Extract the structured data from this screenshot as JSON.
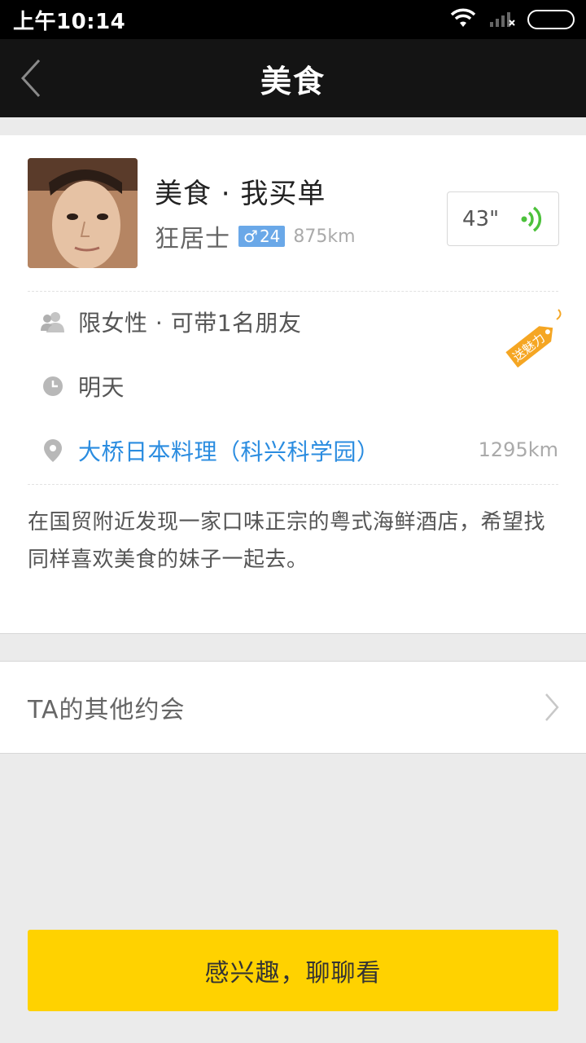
{
  "status_bar": {
    "time": "上午10:14"
  },
  "nav": {
    "title": "美食",
    "back_icon": "chevron-left-icon"
  },
  "post": {
    "title": "美食 · 我买单",
    "user_name": "狂居士",
    "gender_symbol": "♂",
    "age": "24",
    "distance": "875km",
    "voice_duration": "43\"",
    "requirement": "限女性 · 可带1名朋友",
    "time": "明天",
    "place": "大桥日本料理（科兴科学园）",
    "place_distance": "1295km",
    "tag": "送魅力",
    "description": "在国贸附近发现一家口味正宗的粤式海鲜酒店，希望找同样喜欢美食的妹子一起去。"
  },
  "other_dates": {
    "label": "TA的其他约会"
  },
  "cta": {
    "label": "感兴趣，聊聊看"
  },
  "colors": {
    "accent_yellow": "#ffd200",
    "link_blue": "#2a8ce0",
    "gender_blue": "#6aa8e8",
    "voice_green": "#4cc13b",
    "tag_orange": "#f5a623"
  }
}
